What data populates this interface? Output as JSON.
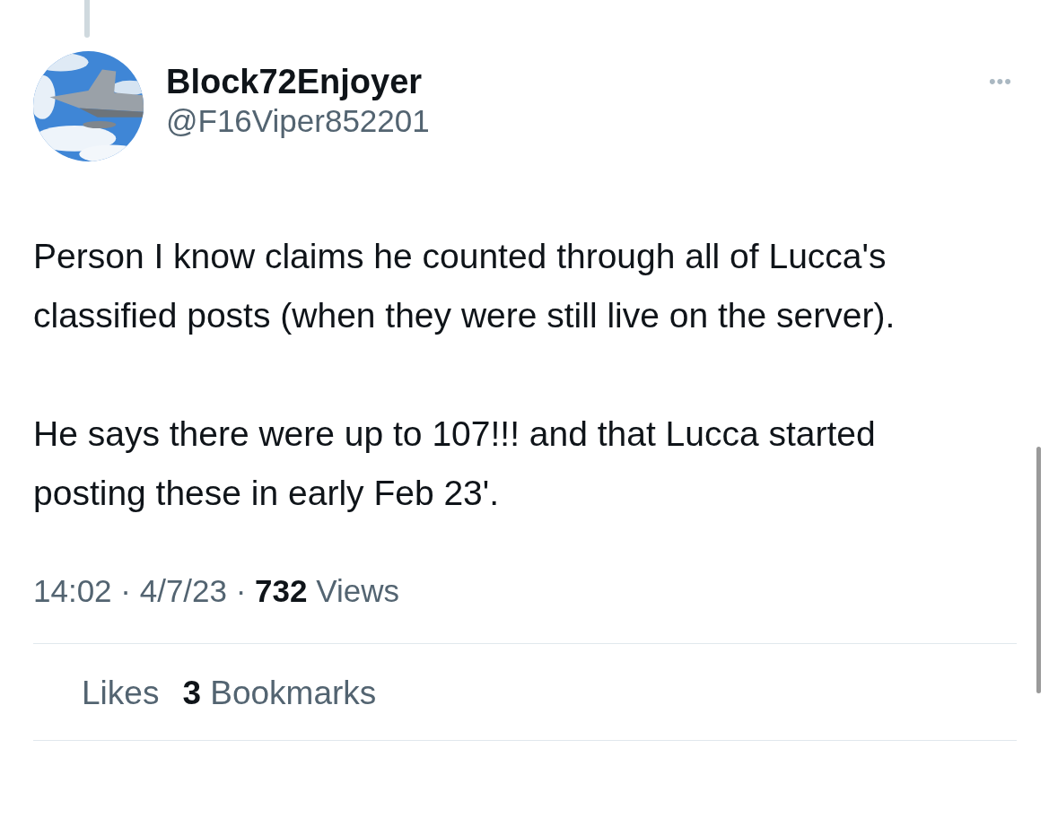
{
  "author": {
    "display_name": "Block72Enjoyer",
    "handle": "@F16Viper852201",
    "menu": "•••"
  },
  "body": [
    "Person I know claims he counted through all of Lucca's classified posts (when they were still live on the server).",
    "He says there were up to 107!!! and that Lucca started posting these in early Feb 23'."
  ],
  "meta": "14:02 · 4/7/23 · **732** Views",
  "stats": [
    {
      "text": "Likes"
    },
    {
      "text": "**3** Bookmarks"
    }
  ]
}
